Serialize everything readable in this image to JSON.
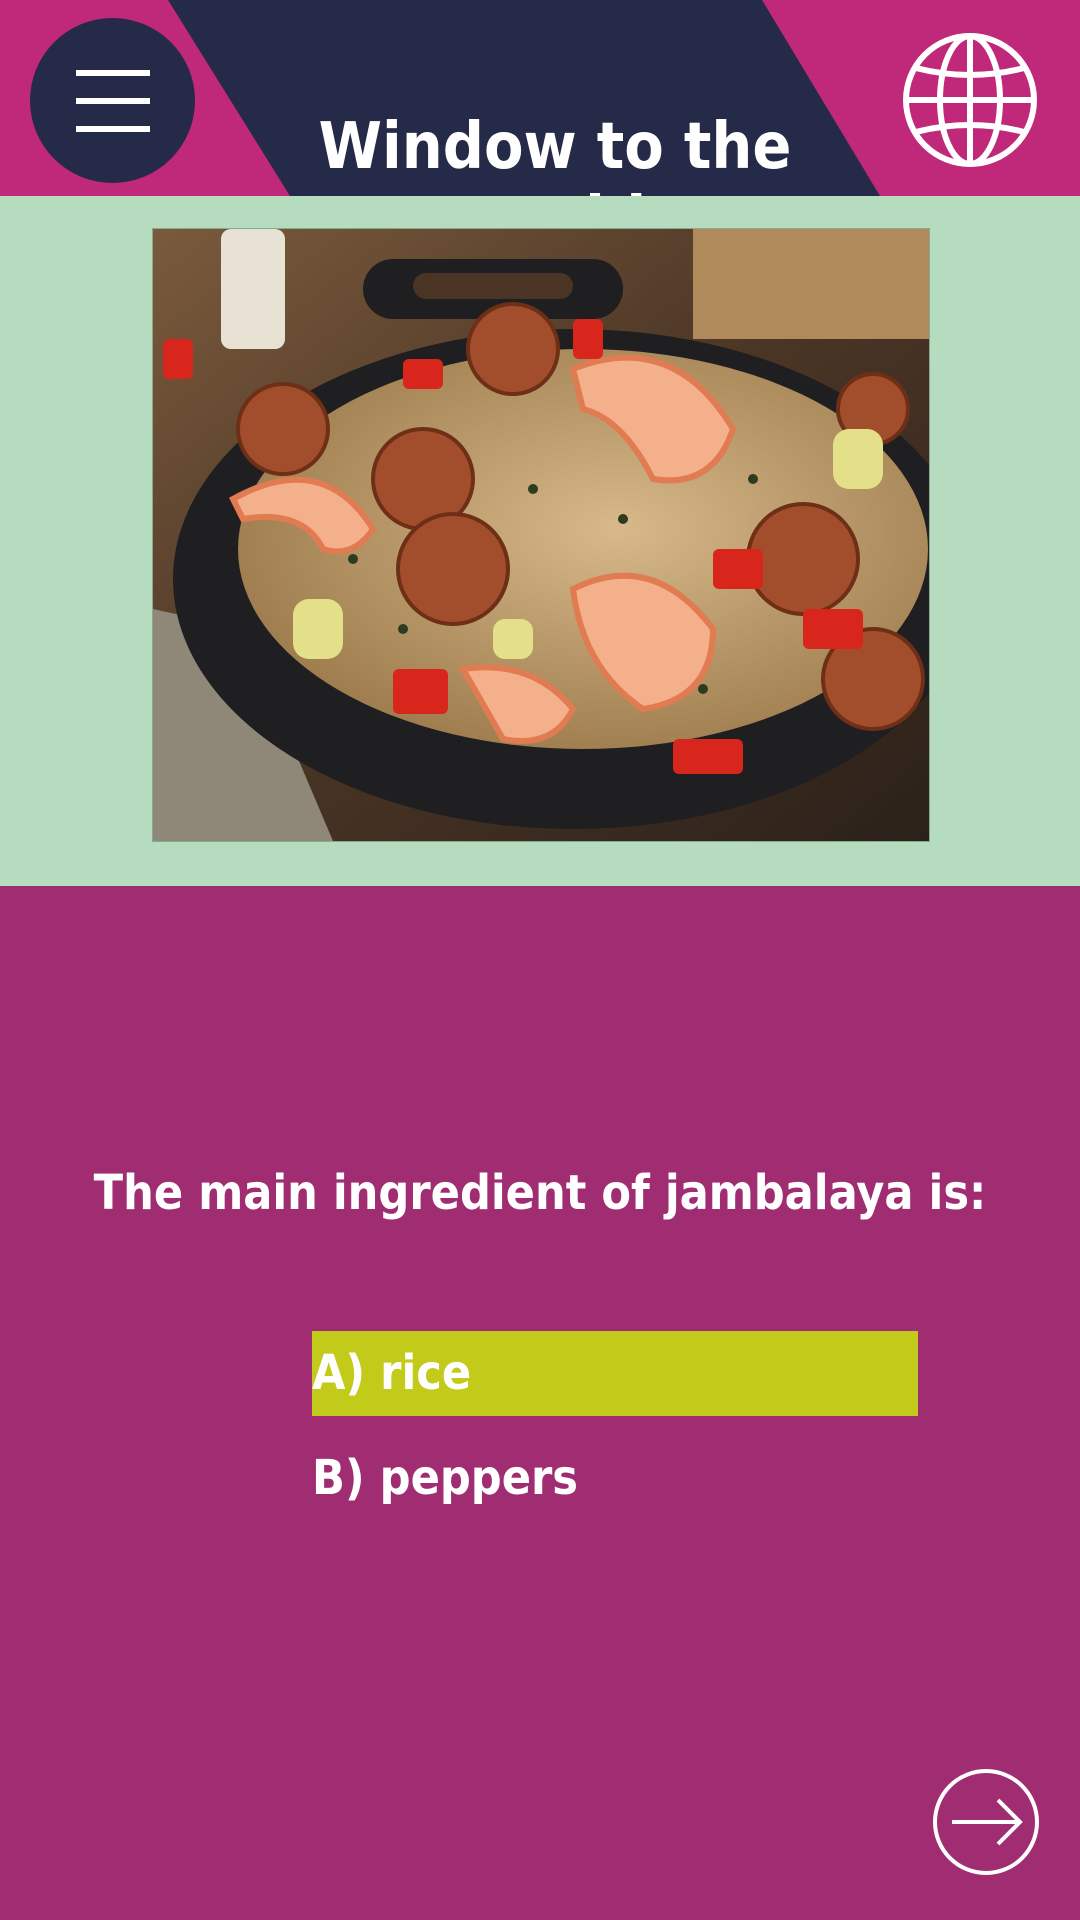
{
  "app": {
    "title": "Window to the world"
  },
  "header": {
    "menu_icon": "hamburger-menu-icon",
    "globe_icon": "globe-icon"
  },
  "quiz": {
    "question": "The main ingredient of jambalaya is:",
    "options": [
      {
        "label": "A) rice",
        "selected": true
      },
      {
        "label": "B) peppers",
        "selected": false
      }
    ]
  },
  "footer": {
    "next_icon": "arrow-right-circle-icon"
  },
  "colors": {
    "header_pink": "#c0287a",
    "banner_navy": "#242a48",
    "banner_stripe": "#14c59a",
    "hero_bg": "#b5dcbf",
    "body_bg": "#a02d72",
    "selected_option": "#c3cb1a"
  }
}
